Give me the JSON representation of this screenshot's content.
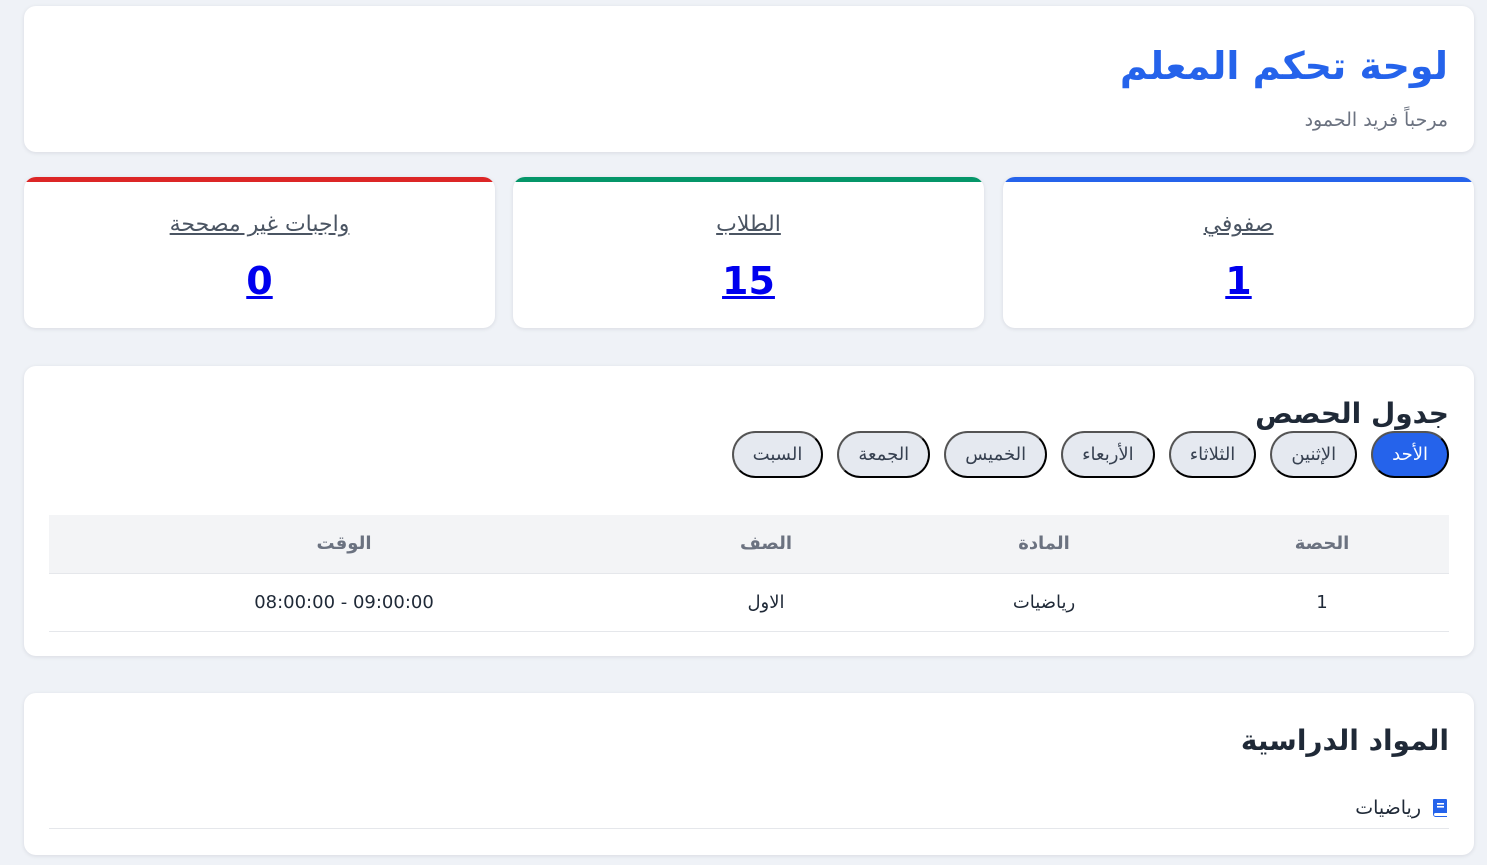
{
  "header": {
    "title": "لوحة تحكم المعلم",
    "welcome": "مرحباً فريد الحمود"
  },
  "stats": [
    {
      "label": "صفوفي",
      "value": "1",
      "color": "#2563eb"
    },
    {
      "label": "الطلاب",
      "value": "15",
      "color": "#059669"
    },
    {
      "label": "واجبات غير مصححة",
      "value": "0",
      "color": "#dc2626"
    }
  ],
  "schedule": {
    "title": "جدول الحصص",
    "days": [
      "الأحد",
      "الإثنين",
      "الثلاثاء",
      "الأربعاء",
      "الخميس",
      "الجمعة",
      "السبت"
    ],
    "active_day": "الأحد",
    "columns": [
      "الحصة",
      "المادة",
      "الصف",
      "الوقت"
    ],
    "rows": [
      {
        "period": "1",
        "subject": "رياضيات",
        "class": "الاول",
        "time": "08:00:00 - 09:00:00"
      }
    ]
  },
  "subjects": {
    "title": "المواد الدراسية",
    "items": [
      {
        "name": "رياضيات",
        "icon": "book-icon"
      }
    ]
  },
  "colors": {
    "accent": "#2563eb",
    "background": "#eff2f7"
  }
}
